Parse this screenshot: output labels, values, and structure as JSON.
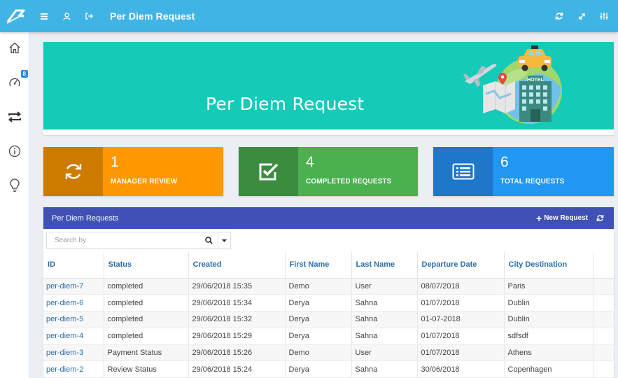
{
  "header": {
    "title": "Per Diem Request",
    "icons": [
      "menu-icon",
      "user-icon",
      "logout-icon",
      "refresh-icon",
      "expand-icon",
      "settings-sliders-icon"
    ]
  },
  "sidebar": {
    "items": [
      {
        "name": "home",
        "icon": "home-icon"
      },
      {
        "name": "dashboard",
        "icon": "speedometer-icon",
        "badge": "8"
      },
      {
        "name": "transfer",
        "icon": "exchange-icon"
      },
      {
        "name": "info",
        "icon": "info-icon"
      },
      {
        "name": "ideas",
        "icon": "lightbulb-icon"
      }
    ]
  },
  "banner": {
    "title": "Per Diem Request",
    "hotel_sign": "HOTEL"
  },
  "stats": [
    {
      "count": "1",
      "label": "MANAGER REVIEW",
      "icon": "sync-icon",
      "color": "#ff9800",
      "icon_bg": "#cc7a00"
    },
    {
      "count": "4",
      "label": "COMPLETED REQUESTS",
      "icon": "check-square-icon",
      "color": "#4caf50",
      "icon_bg": "#3b8c3f"
    },
    {
      "count": "6",
      "label": "TOTAL REQUESTS",
      "icon": "list-icon",
      "color": "#2196f3",
      "icon_bg": "#1f77c9"
    }
  ],
  "panel": {
    "title": "Per Diem Requests",
    "new_label": "New Request",
    "search_placeholder": "Search by"
  },
  "table": {
    "columns": [
      "ID",
      "Status",
      "Created",
      "First Name",
      "Last Name",
      "Departure Date",
      "City Destination"
    ],
    "rows": [
      [
        "per-diem-7",
        "completed",
        "29/06/2018 15:35",
        "Demo",
        "User",
        "08/07/2018",
        "Paris"
      ],
      [
        "per-diem-6",
        "completed",
        "29/06/2018 15:34",
        "Derya",
        "Sahna",
        "01/07/2018",
        "Dublin"
      ],
      [
        "per-diem-5",
        "completed",
        "29/06/2018 15:32",
        "Derya",
        "Sahna",
        "01-07-2018",
        "Dublin"
      ],
      [
        "per-diem-4",
        "completed",
        "29/06/2018 15:29",
        "Derya",
        "Sahna",
        "01/07/2018",
        "sdfsdf"
      ],
      [
        "per-diem-3",
        "Payment Status",
        "29/06/2018 15:26",
        "Demo",
        "User",
        "01/07/2018",
        "Athens"
      ],
      [
        "per-diem-2",
        "Review Status",
        "29/06/2018 15:24",
        "Derya",
        "Sahna",
        "30/06/2018",
        "Copenhagen"
      ]
    ]
  },
  "colors": {
    "topbar": "#41b4e6",
    "banner": "#14cbb7",
    "panel_header": "#3f51b5",
    "link": "#2a6fa8"
  }
}
